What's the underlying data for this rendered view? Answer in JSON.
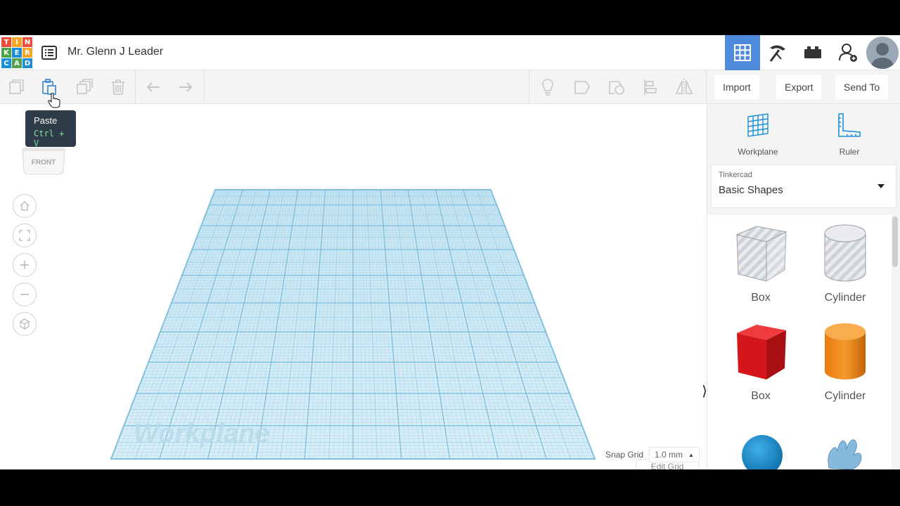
{
  "header": {
    "logo_letters": [
      "T",
      "I",
      "N",
      "K",
      "E",
      "R",
      "C",
      "A",
      "D"
    ],
    "logo_colors": [
      "#e94e3d",
      "#f5a623",
      "#e94e3d",
      "#4fa34d",
      "#1a8fd8",
      "#f5a623",
      "#1a8fd8",
      "#4fa34d",
      "#1a8fd8"
    ],
    "design_title": "Mr. Glenn J Leader",
    "accent_color": "#4f8bdc",
    "mode_buttons": [
      "3d-design-view",
      "codeblocks",
      "bricks",
      "invite-user"
    ]
  },
  "toolbar": {
    "icons": [
      "copy",
      "paste",
      "duplicate",
      "delete",
      "undo",
      "redo",
      "light",
      "group",
      "ungroup",
      "align",
      "mirror"
    ],
    "import_label": "Import",
    "export_label": "Export",
    "send_to_label": "Send To"
  },
  "tooltip": {
    "title": "Paste",
    "shortcut": "Ctrl + V"
  },
  "viewcube": {
    "face_label": "FRONT"
  },
  "canvas": {
    "workplane_label": "Workplane",
    "edit_grid_label": "Edit Grid",
    "snap_grid_label": "Snap Grid",
    "snap_grid_value": "1.0 mm",
    "grid_color": "#8cc9e4"
  },
  "panel": {
    "tools": [
      {
        "label": "Workplane",
        "icon": "workplane-icon"
      },
      {
        "label": "Ruler",
        "icon": "ruler-icon"
      }
    ],
    "library": {
      "source": "Tinkercad",
      "name": "Basic Shapes"
    },
    "shapes": [
      {
        "label": "Box",
        "style": "hole"
      },
      {
        "label": "Cylinder",
        "style": "hole"
      },
      {
        "label": "Box",
        "style": "solid",
        "color": "#e2141b"
      },
      {
        "label": "Cylinder",
        "style": "solid",
        "color": "#f08a1c"
      },
      {
        "label": "",
        "style": "solid",
        "color": "#1691d5"
      },
      {
        "label": "",
        "style": "solid",
        "color": "#7fb7dd"
      }
    ]
  }
}
